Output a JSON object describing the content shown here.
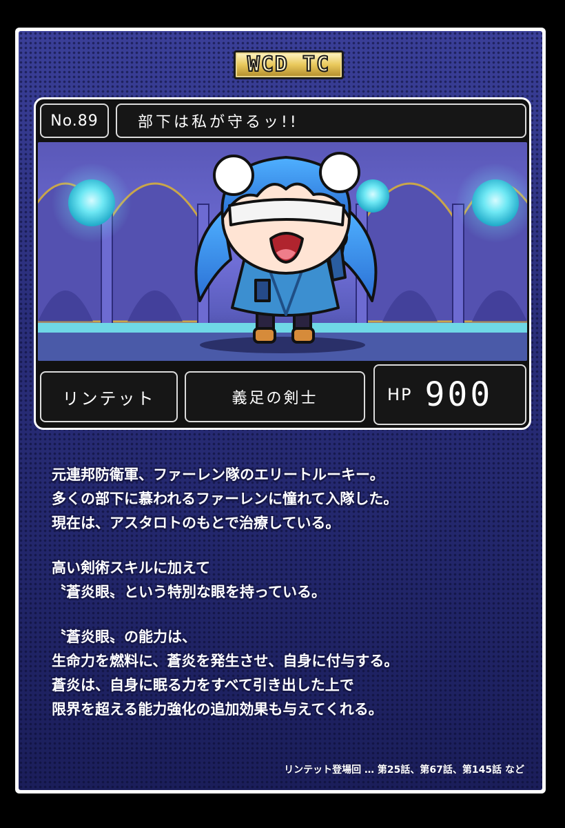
{
  "card": {
    "logo": "WCD TC",
    "number": "No.89",
    "quote": "部下は私が守るッ!!",
    "name": "リンテット",
    "title": "義足の剣士",
    "hp_label": "HP",
    "hp_value": "900"
  },
  "description": {
    "paragraphs": [
      {
        "lines": [
          "元連邦防衛軍、ファーレン隊のエリートルーキー。",
          "多くの部下に慕われるファーレンに憧れて入隊した。",
          "現在は、アスタロトのもとで治療している。"
        ]
      },
      {
        "lines": [
          "高い剣術スキルに加えて",
          "〝蒼炎眼〟という特別な眼を持っている。"
        ]
      },
      {
        "lines": [
          "〝蒼炎眼〟の能力は、",
          "生命力を燃料に、蒼炎を発生させ、自身に付与する。",
          "蒼炎は、自身に眠る力をすべて引き出した上で",
          "限界を超える能力強化の追加効果も与えてくれる。"
        ]
      }
    ]
  },
  "episodes": "リンテット登場回 … 第25話、第67話、第145話 など",
  "colors": {
    "card_bg": "#2b2f74",
    "gold": "#e9c85b",
    "hair": "#3a8fe0",
    "orb": "#5fe4f0"
  },
  "icons": [
    "character-illustration",
    "glowing-orb-icon"
  ]
}
